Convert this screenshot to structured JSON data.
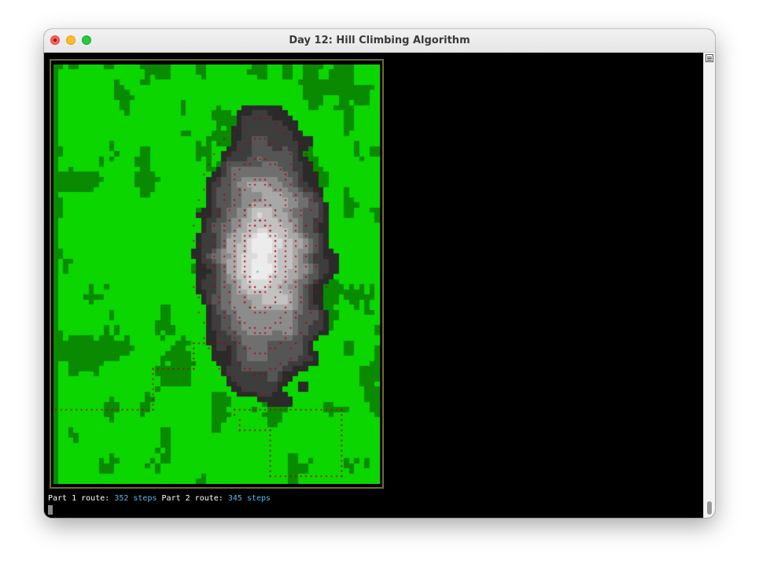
{
  "window": {
    "title": "Day 12: Hill Climbing Algorithm"
  },
  "status_line": {
    "part1_label": "Part 1 route:",
    "part1_value": "352 steps",
    "part2_label": "Part 2 route:",
    "part2_value": "345 steps"
  },
  "colors": {
    "grass_light": "#0bd600",
    "grass_dark": "#0a8a00",
    "path_dot": "#b00000",
    "highlight_text": "#59b8e6",
    "frame": "#6e6a32",
    "window_close": "#fe5f57",
    "window_minimize": "#febc2e",
    "window_maximize": "#28c840"
  },
  "icons": {
    "close": "close-icon",
    "minimize": "minimize-icon",
    "maximize": "maximize-icon",
    "scroll_menu": "menu-icon"
  }
}
